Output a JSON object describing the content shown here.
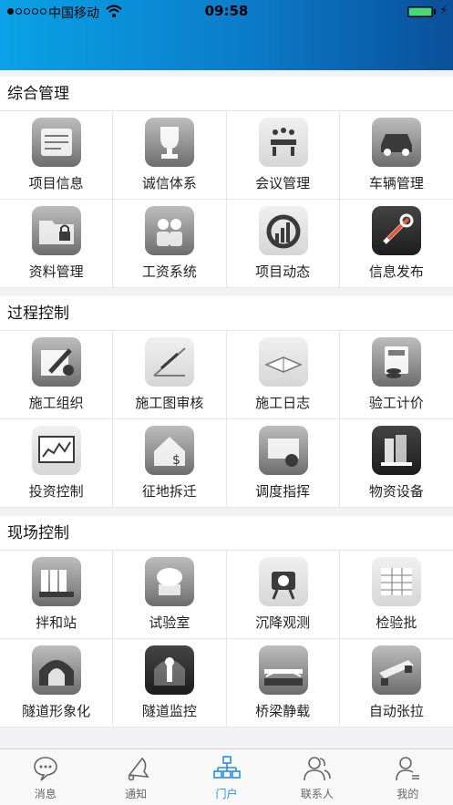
{
  "status_bar": {
    "carrier": "中国移动",
    "time": "09:58"
  },
  "sections": [
    {
      "title": "综合管理",
      "items": [
        {
          "label": "项目信息",
          "icon": "map-scroll-icon"
        },
        {
          "label": "诚信体系",
          "icon": "trophy-icon"
        },
        {
          "label": "会议管理",
          "icon": "meeting-icon"
        },
        {
          "label": "车辆管理",
          "icon": "car-icon"
        },
        {
          "label": "资料管理",
          "icon": "locked-folder-icon"
        },
        {
          "label": "工资系统",
          "icon": "workers-icon"
        },
        {
          "label": "项目动态",
          "icon": "gauge-icon"
        },
        {
          "label": "信息发布",
          "icon": "tools-icon"
        }
      ]
    },
    {
      "title": "过程控制",
      "items": [
        {
          "label": "施工组织",
          "icon": "pen-paper-icon"
        },
        {
          "label": "施工图审核",
          "icon": "blueprint-icon"
        },
        {
          "label": "施工日志",
          "icon": "open-book-icon"
        },
        {
          "label": "验工计价",
          "icon": "calculator-coins-icon"
        },
        {
          "label": "投资控制",
          "icon": "monitor-chart-icon"
        },
        {
          "label": "征地拆迁",
          "icon": "house-dollar-icon"
        },
        {
          "label": "调度指挥",
          "icon": "dispatch-folder-icon"
        },
        {
          "label": "物资设备",
          "icon": "buildings-icon"
        }
      ]
    },
    {
      "title": "现场控制",
      "items": [
        {
          "label": "拌和站",
          "icon": "silos-icon"
        },
        {
          "label": "试验室",
          "icon": "lab-instrument-icon"
        },
        {
          "label": "沉降观测",
          "icon": "surveying-camera-icon"
        },
        {
          "label": "检验批",
          "icon": "spreadsheet-icon"
        },
        {
          "label": "隧道形象化",
          "icon": "tunnel-icon"
        },
        {
          "label": "隧道监控",
          "icon": "tunnel-monitor-icon"
        },
        {
          "label": "桥梁静载",
          "icon": "bridge-icon"
        },
        {
          "label": "自动张拉",
          "icon": "jack-beam-icon"
        }
      ]
    }
  ],
  "tabbar": [
    {
      "label": "消息",
      "icon": "chat-bubble-icon",
      "active": false
    },
    {
      "label": "通知",
      "icon": "bell-icon",
      "active": false
    },
    {
      "label": "门户",
      "icon": "org-chart-icon",
      "active": true
    },
    {
      "label": "联系人",
      "icon": "contacts-icon",
      "active": false
    },
    {
      "label": "我的",
      "icon": "profile-icon",
      "active": false
    }
  ],
  "colors": {
    "header_start": "#0aa2e6",
    "header_end": "#0a4f99",
    "tab_active": "#2a90e0"
  }
}
